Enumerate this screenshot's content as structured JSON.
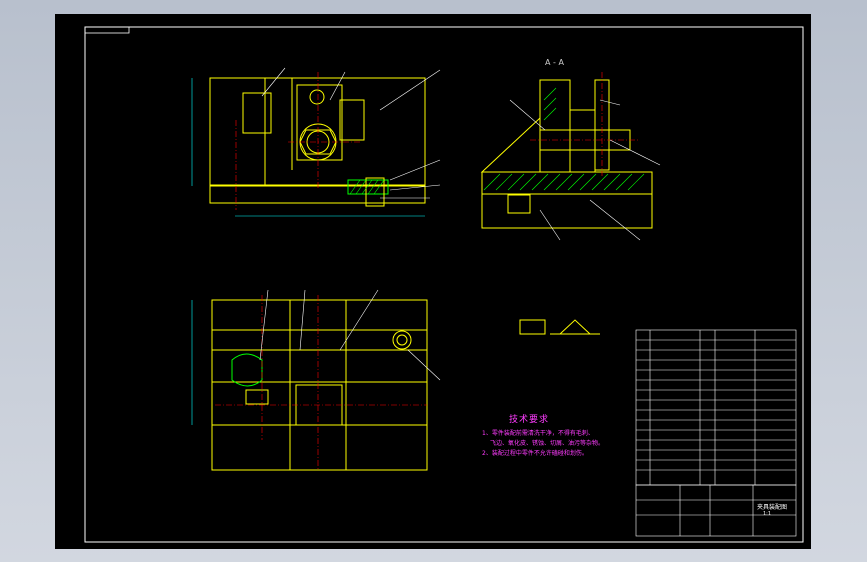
{
  "section": {
    "label": "A - A"
  },
  "technical_requirements": {
    "title": "技术要求",
    "notes": [
      "1、零件装配前需清洗干净，不得有毛刺、",
      "飞边、氧化皮、锈蚀、切屑、油污等杂物。",
      "2、装配过程中零件不允许磕碰和划伤。"
    ]
  },
  "title_block": {
    "drawing_title": "夹具装配图",
    "scale": "1:1"
  },
  "colors": {
    "background": "#000000",
    "outline": "#ffff00",
    "leader": "#ffffff",
    "hatch": "#00ff00",
    "center": "#ff0000",
    "text": "#ff00ff",
    "dimension": "#00ffff"
  }
}
